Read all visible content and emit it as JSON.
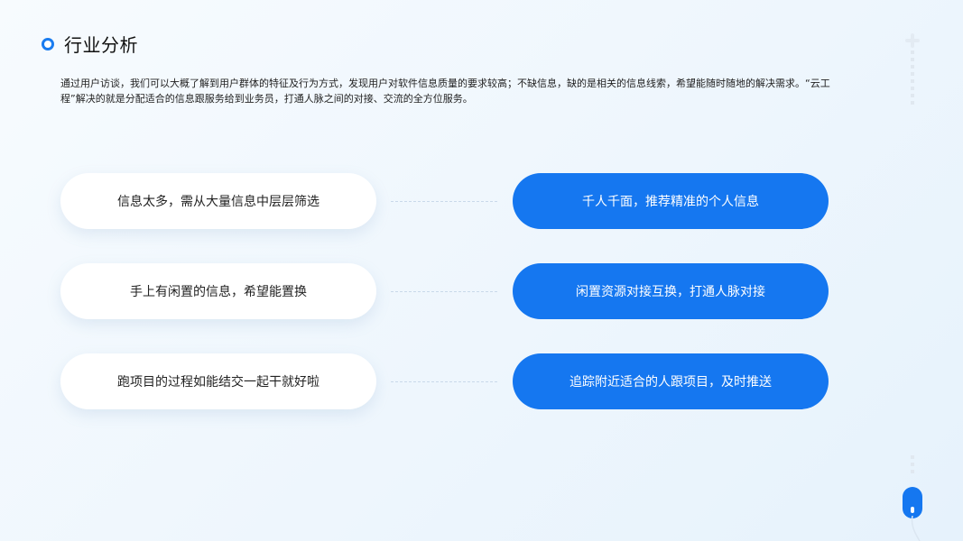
{
  "section": {
    "title": "行业分析",
    "description": "通过用户访谈，我们可以大概了解到用户群体的特征及行为方式，发现用户对软件信息质量的要求较高；不缺信息，缺的是相关的信息线索，希望能随时随地的解决需求。“云工程”解决的就是分配适合的信息跟服务给到业务员，打通人脉之间的对接、交流的全方位服务。"
  },
  "rows": [
    {
      "problem": "信息太多，需从大量信息中层层筛选",
      "solution": "千人千面，推荐精准的个人信息"
    },
    {
      "problem": "手上有闲置的信息，希望能置换",
      "solution": "闲置资源对接互换，打通人脉对接"
    },
    {
      "problem": "跑项目的过程如能结交一起干就好啦",
      "solution": "追踪附近适合的人跟项目，及时推送"
    }
  ],
  "colors": {
    "accent": "#1577f0",
    "background": "#eef6fd"
  },
  "icons": {
    "title_marker": "circle-ring-icon",
    "decor_top": "plus-cross-icon",
    "decor_bottom": "mouse-scroll-icon"
  }
}
